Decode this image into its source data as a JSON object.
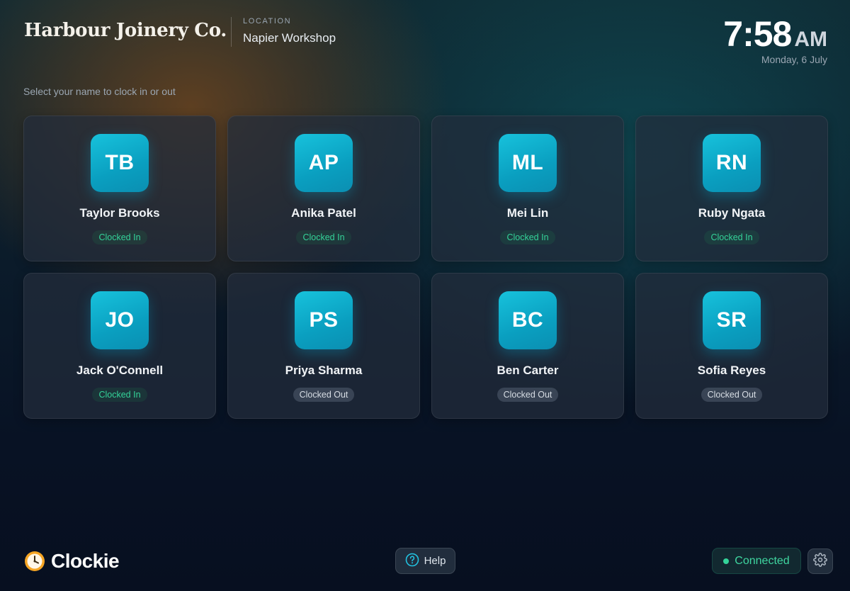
{
  "header": {
    "brand": "Harbour Joinery Co.",
    "location_label": "LOCATION",
    "location": "Napier Workshop",
    "time": "7:58",
    "ampm": "AM",
    "date": "Monday, 6 July"
  },
  "prompt": "Select your name to clock in or out",
  "employees": [
    {
      "initials": "TB",
      "name": "Taylor Brooks",
      "status": "Clocked In"
    },
    {
      "initials": "AP",
      "name": "Anika Patel",
      "status": "Clocked In"
    },
    {
      "initials": "ML",
      "name": "Mei Lin",
      "status": "Clocked In"
    },
    {
      "initials": "RN",
      "name": "Ruby Ngata",
      "status": "Clocked In"
    },
    {
      "initials": "JO",
      "name": "Jack O'Connell",
      "status": "Clocked In"
    },
    {
      "initials": "PS",
      "name": "Priya Sharma",
      "status": "Clocked Out"
    },
    {
      "initials": "BC",
      "name": "Ben Carter",
      "status": "Clocked Out"
    },
    {
      "initials": "SR",
      "name": "Sofia Reyes",
      "status": "Clocked Out"
    }
  ],
  "footer": {
    "app_name": "Clockie",
    "logo_icon": "clock-icon",
    "help_label": "Help",
    "help_icon": "question-circle-icon",
    "connection_status": "Connected",
    "settings_icon": "gear-icon"
  },
  "colors": {
    "accent": "#0fb3d4",
    "clocked_in": "#34d399",
    "clocked_out": "#d7dde4"
  }
}
